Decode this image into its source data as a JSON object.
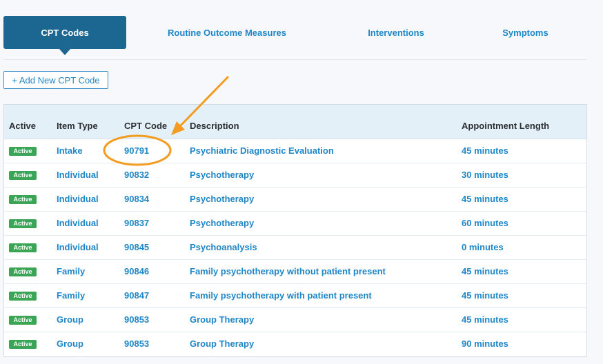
{
  "tabs": [
    {
      "label": "CPT Codes",
      "active": true
    },
    {
      "label": "Routine Outcome Measures",
      "active": false
    },
    {
      "label": "Interventions",
      "active": false
    },
    {
      "label": "Symptoms",
      "active": false
    }
  ],
  "add_button": {
    "label": "+ Add New CPT Code"
  },
  "table": {
    "headers": [
      "Active",
      "Item Type",
      "CPT Code",
      "Description",
      "Appointment Length"
    ],
    "rows": [
      {
        "status": "Active",
        "item_type": "Intake",
        "code": "90791",
        "description": "Psychiatric Diagnostic Evaluation",
        "length": "45 minutes"
      },
      {
        "status": "Active",
        "item_type": "Individual",
        "code": "90832",
        "description": "Psychotherapy",
        "length": "30 minutes"
      },
      {
        "status": "Active",
        "item_type": "Individual",
        "code": "90834",
        "description": "Psychotherapy",
        "length": "45 minutes"
      },
      {
        "status": "Active",
        "item_type": "Individual",
        "code": "90837",
        "description": "Psychotherapy",
        "length": "60 minutes"
      },
      {
        "status": "Active",
        "item_type": "Individual",
        "code": "90845",
        "description": "Psychoanalysis",
        "length": "0 minutes"
      },
      {
        "status": "Active",
        "item_type": "Family",
        "code": "90846",
        "description": "Family psychotherapy without patient present",
        "length": "45 minutes"
      },
      {
        "status": "Active",
        "item_type": "Family",
        "code": "90847",
        "description": "Family psychotherapy with patient present",
        "length": "45 minutes"
      },
      {
        "status": "Active",
        "item_type": "Group",
        "code": "90853",
        "description": "Group Therapy",
        "length": "45 minutes"
      },
      {
        "status": "Active",
        "item_type": "Group",
        "code": "90853",
        "description": "Group Therapy",
        "length": "90 minutes"
      }
    ]
  },
  "colors": {
    "accent": "#1c6792",
    "link": "#1f87c8",
    "active_badge": "#3aa655",
    "header_bg": "#e4f0f8",
    "annotation": "#f39c1f"
  }
}
